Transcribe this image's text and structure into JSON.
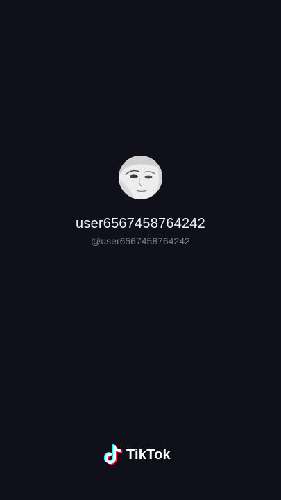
{
  "profile": {
    "display_name": "user6567458764242",
    "handle": "@user6567458764242"
  },
  "brand": {
    "name": "TikTok",
    "icon": "tiktok-note-icon"
  },
  "colors": {
    "background": "#10101a",
    "primary_text": "#f2f2f2",
    "secondary_text": "#7d7d85",
    "logo_cyan": "#25f4ee",
    "logo_pink": "#fe2c55"
  }
}
